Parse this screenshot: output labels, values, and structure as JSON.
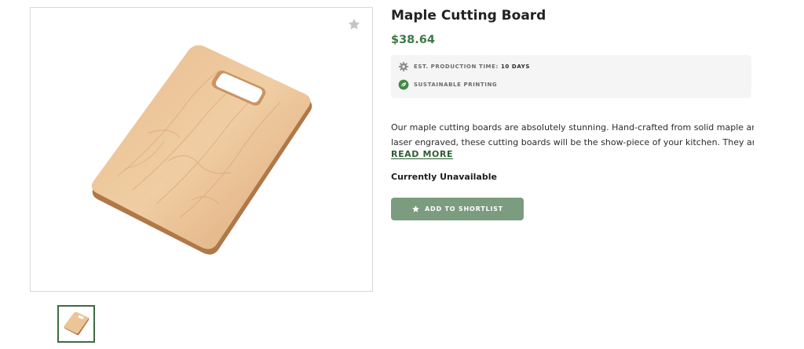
{
  "product": {
    "title": "Maple Cutting Board",
    "price": "$38.64",
    "image_alt": "Maple cutting board with handle cut-out",
    "favorite_icon": "star-icon",
    "thumbnail_count": 1
  },
  "info": {
    "production_label": "EST. PRODUCTION TIME:",
    "production_value": "10 DAYS",
    "production_icon": "gear-icon",
    "sustainable_label": "SUSTAINABLE PRINTING",
    "sustainable_icon": "leaf-icon"
  },
  "description": {
    "line1": "Our maple cutting boards are absolutely stunning. Hand-crafted from solid maple and",
    "line2": "laser engraved, these cutting boards will be the show-piece of your kitchen. They ar…",
    "read_more": "READ MORE"
  },
  "availability": "Currently Unavailable",
  "actions": {
    "shortlist_label": "ADD TO SHORTLIST",
    "shortlist_icon": "star-icon"
  },
  "colors": {
    "accent_green": "#3d7a45",
    "button_green": "#7b9c7e",
    "info_bg": "#f5f5f5"
  }
}
